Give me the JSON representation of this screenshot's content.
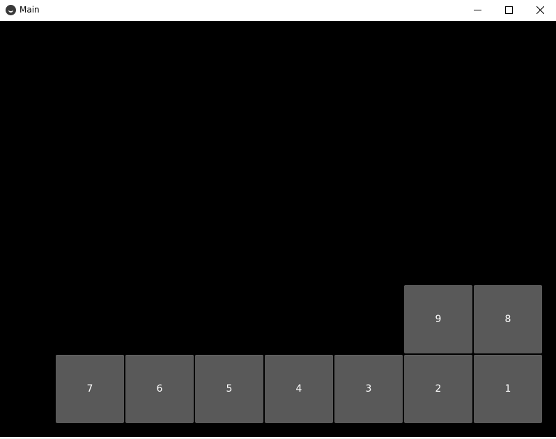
{
  "window": {
    "title": "Main",
    "controls": {
      "minimize": "minimize",
      "maximize": "maximize",
      "close": "close"
    }
  },
  "buttons": {
    "b1": "1",
    "b2": "2",
    "b3": "3",
    "b4": "4",
    "b5": "5",
    "b6": "6",
    "b7": "7",
    "b8": "8",
    "b9": "9"
  },
  "colors": {
    "background": "#000000",
    "button": "#595959",
    "button_text": "#ffffff"
  }
}
